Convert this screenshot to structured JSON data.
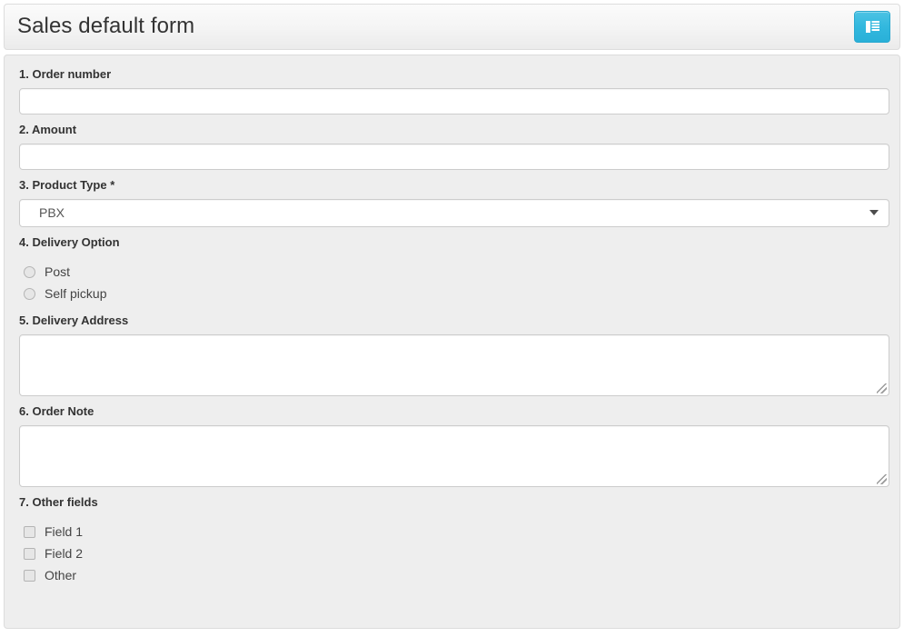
{
  "header": {
    "title": "Sales default form",
    "action_button_icon": "th-list-icon",
    "accent_color": "#32b8de"
  },
  "form": {
    "fields": [
      {
        "label": "1. Order number",
        "type": "text",
        "value": "",
        "placeholder": ""
      },
      {
        "label": "2. Amount",
        "type": "text",
        "value": "",
        "placeholder": ""
      },
      {
        "label": "3. Product Type",
        "required_marker": "*",
        "type": "select",
        "value": "PBX"
      },
      {
        "label": "4. Delivery Option",
        "type": "radio",
        "options": [
          {
            "label": "Post",
            "checked": false
          },
          {
            "label": "Self pickup",
            "checked": false
          }
        ]
      },
      {
        "label": "5. Delivery Address",
        "type": "textarea",
        "value": "",
        "placeholder": ""
      },
      {
        "label": "6. Order Note",
        "type": "textarea",
        "value": "",
        "placeholder": ""
      },
      {
        "label": "7. Other fields",
        "type": "checkbox",
        "options": [
          {
            "label": "Field 1",
            "checked": false
          },
          {
            "label": "Field 2",
            "checked": false
          },
          {
            "label": "Other",
            "checked": false
          }
        ]
      }
    ]
  }
}
